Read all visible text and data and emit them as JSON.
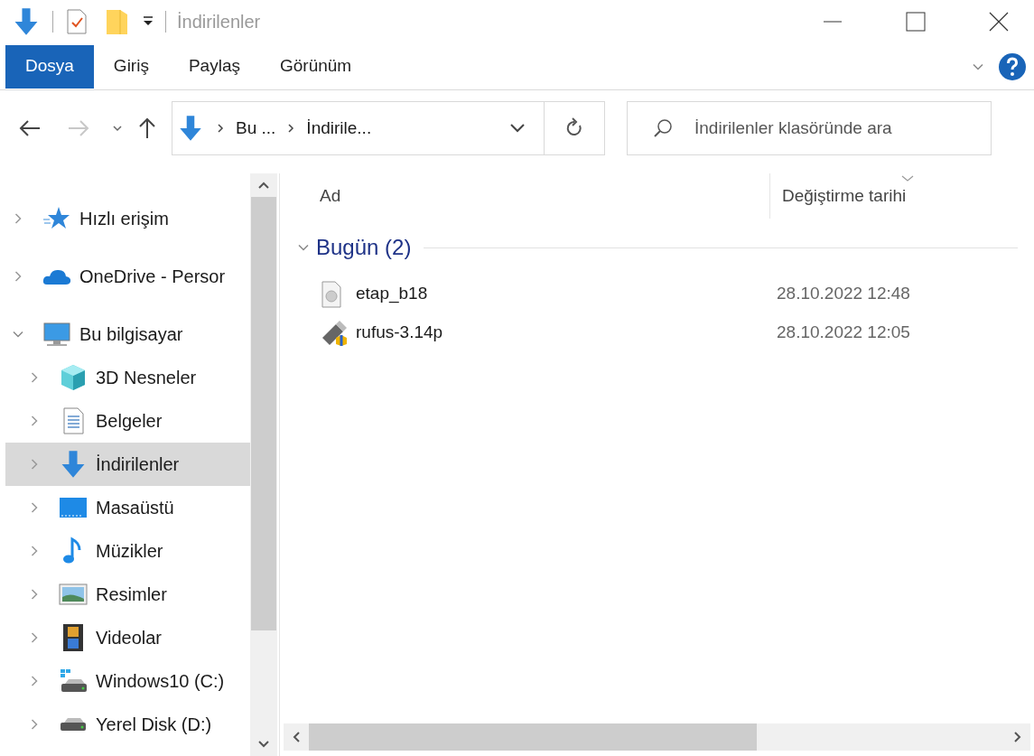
{
  "window": {
    "title": "İndirilenler"
  },
  "ribbon_tabs": [
    {
      "label": "Dosya",
      "selected": true
    },
    {
      "label": "Giriş",
      "selected": false
    },
    {
      "label": "Paylaş",
      "selected": false
    },
    {
      "label": "Görünüm",
      "selected": false
    }
  ],
  "address_bar": {
    "segments": [
      "Bu ...",
      "İndirile..."
    ]
  },
  "search": {
    "placeholder": "İndirilenler klasöründe ara"
  },
  "navigation": [
    {
      "label": "Hızlı erişim",
      "kind": "star",
      "expanded": false,
      "selected": false
    },
    {
      "label": "OneDrive - Persor",
      "kind": "cloud",
      "expanded": false,
      "selected": false
    },
    {
      "label": "Bu bilgisayar",
      "kind": "pc",
      "expanded": true,
      "selected": false,
      "children": [
        {
          "label": "3D Nesneler",
          "kind": "cube",
          "expanded": false,
          "selected": false
        },
        {
          "label": "Belgeler",
          "kind": "document",
          "expanded": false,
          "selected": false
        },
        {
          "label": "İndirilenler",
          "kind": "download",
          "expanded": false,
          "selected": true
        },
        {
          "label": "Masaüstü",
          "kind": "desktop",
          "expanded": false,
          "selected": false
        },
        {
          "label": "Müzikler",
          "kind": "music",
          "expanded": false,
          "selected": false
        },
        {
          "label": "Resimler",
          "kind": "pictures",
          "expanded": false,
          "selected": false
        },
        {
          "label": "Videolar",
          "kind": "video",
          "expanded": false,
          "selected": false
        },
        {
          "label": "Windows10 (C:)",
          "kind": "windows-drive",
          "expanded": false,
          "selected": false
        },
        {
          "label": "Yerel Disk (D:)",
          "kind": "drive",
          "expanded": false,
          "selected": false
        }
      ]
    }
  ],
  "file_list": {
    "columns": [
      "Ad",
      "Değiştirme tarihi"
    ],
    "groups": [
      {
        "title": "Bugün (2)",
        "expanded": true,
        "rows": [
          {
            "name": "etap_b18",
            "kind": "disc-image",
            "modified": "28.10.2022 12:48"
          },
          {
            "name": "rufus-3.14p",
            "kind": "usb-app",
            "modified": "28.10.2022 12:05"
          }
        ]
      }
    ]
  }
}
